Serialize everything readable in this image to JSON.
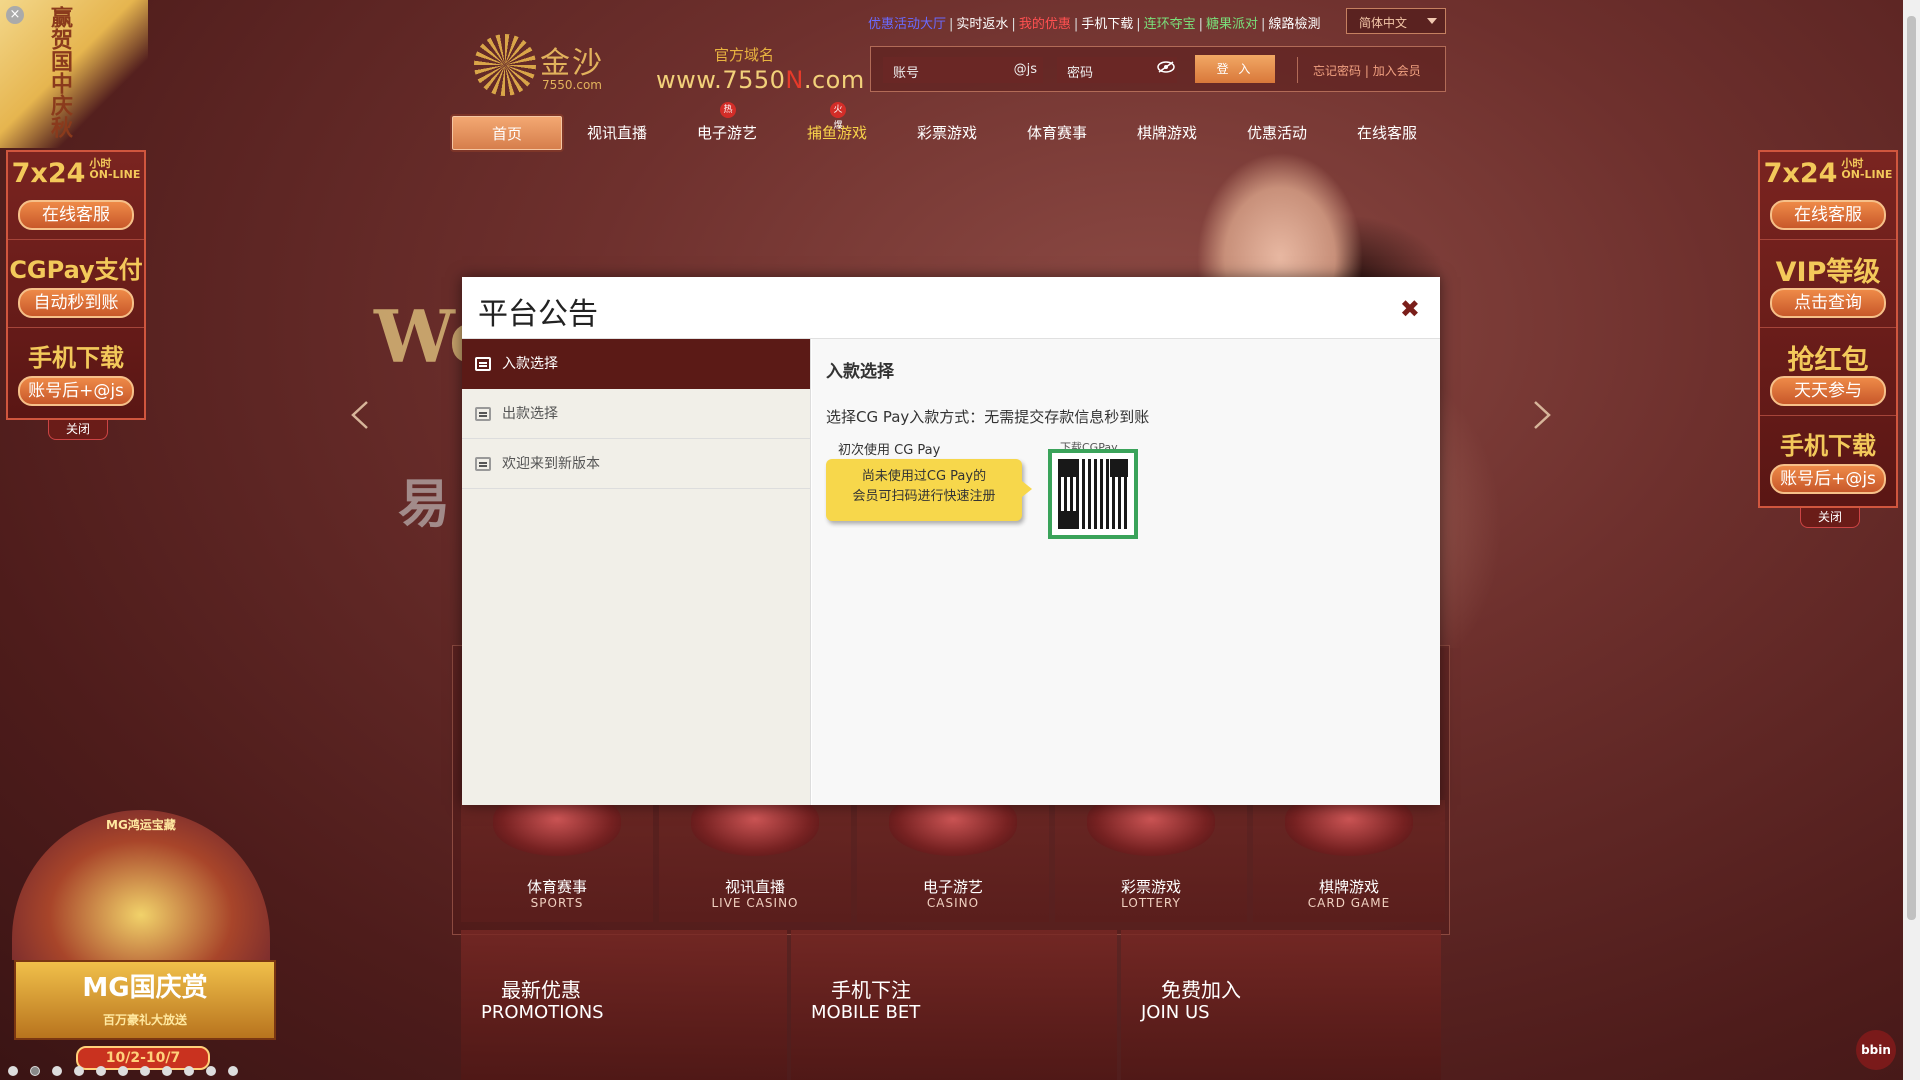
{
  "toplinks": [
    "优惠活动大厅",
    "实时返水",
    "我的优惠",
    "手机下载",
    "连环夺宝",
    "糖果派对",
    "線路檢測"
  ],
  "toplink_colors": [
    "#6a6aff",
    "#ffffff",
    "#ff5050",
    "#ffffff",
    "#7adf7a",
    "#7adf7a",
    "#ffffff"
  ],
  "language": "简体中文",
  "logo": {
    "name": "金沙",
    "domain": "7550.com"
  },
  "official_label": "官方域名",
  "official_url": {
    "prefix": "www.7550",
    "highlight": "N",
    "suffix": ".com"
  },
  "login": {
    "account_placeholder": "账号",
    "account_suffix": "@js",
    "password_placeholder": "密码",
    "login_button": "登 入",
    "forgot": "忘记密码",
    "join": "加入会员"
  },
  "nav": [
    {
      "label": "首页",
      "active": true
    },
    {
      "label": "视讯直播"
    },
    {
      "label": "电子游艺",
      "badge": "热"
    },
    {
      "label": "捕鱼游戏",
      "badge": "火爆"
    },
    {
      "label": "彩票游戏"
    },
    {
      "label": "体育赛事"
    },
    {
      "label": "棋牌游戏"
    },
    {
      "label": "优惠活动"
    },
    {
      "label": "在线客服"
    }
  ],
  "hero": {
    "welcome": "We",
    "easy": "易"
  },
  "games": [
    {
      "title": "体育赛事",
      "en": "SPORTS"
    },
    {
      "title": "视讯直播",
      "en": "LIVE CASINO"
    },
    {
      "title": "电子游艺",
      "en": "CASINO"
    },
    {
      "title": "彩票游戏",
      "en": "LOTTERY"
    },
    {
      "title": "棋牌游戏",
      "en": "CARD GAME"
    }
  ],
  "promos": [
    {
      "title": "最新优惠",
      "en": "PROMOTIONS"
    },
    {
      "title": "手机下注",
      "en": "MOBILE BET"
    },
    {
      "title": "免费加入",
      "en": "JOIN US"
    }
  ],
  "left_side": {
    "cs_big": "7x24",
    "cs_small1": "小时",
    "cs_small2": "ON-LINE",
    "cs_pill": "在线客服",
    "cgpay_big": "CGPay支付",
    "cgpay_pill": "自动秒到账",
    "app_big": "手机下载",
    "app_pill": "账号后+@js",
    "close": "关闭"
  },
  "right_side": {
    "cs_big": "7x24",
    "cs_small1": "小时",
    "cs_small2": "ON-LINE",
    "cs_pill": "在线客服",
    "vip_big": "VIP等级",
    "vip_pill": "点击查询",
    "redpack_big": "抢红包",
    "redpack_pill": "天天参与",
    "app_big": "手机下载",
    "app_pill": "账号后+@js",
    "close": "关闭"
  },
  "corner_ad": {
    "text": "赢贺国中庆秋"
  },
  "mg_ad": {
    "top": "MG鸿运宝藏",
    "title": "MG国庆赏",
    "sub": "百万豪礼大放送",
    "date": "10/2-10/7"
  },
  "brand_badge": "bbin",
  "modal": {
    "title": "平台公告",
    "close": "✖",
    "tabs": [
      "入款选择",
      "出款选择",
      "欢迎来到新版本"
    ],
    "active_tab": 0,
    "content_title": "入款选择",
    "content_desc": "选择CG Pay入款方式：无需提交存款信息秒到账",
    "first_use": "初次使用 CG Pay",
    "bubble_line1": "尚未使用过CG Pay的",
    "bubble_line2": "会员可扫码进行快速注册",
    "download_label": "下载CGPay"
  }
}
